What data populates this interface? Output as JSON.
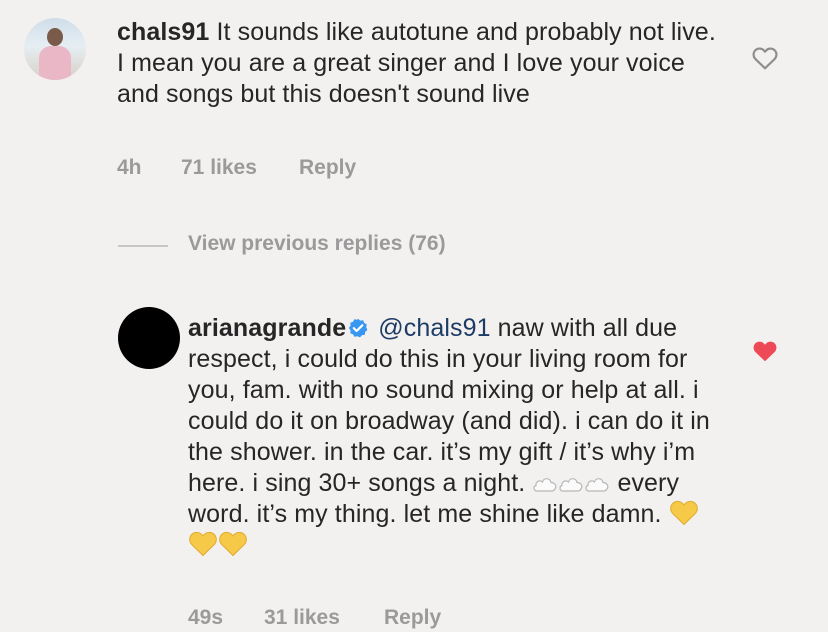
{
  "comments": [
    {
      "username": "chals91",
      "text": "It sounds like autotune and probably not live. I mean you are a great singer and I love your voice and songs but this doesn't sound live",
      "time": "4h",
      "likes": "71 likes",
      "reply_label": "Reply",
      "liked": false
    },
    {
      "username": "arianagrande",
      "verified": true,
      "mention": "@chals91",
      "text_before_emoji": "naw with all due respect, i could do this in your living room for you, fam. with no sound mixing or help at all. i could do it on broadway (and did). i can do it in the shower. in the car. it’s my gift / it’s why i’m here. i sing 30+ songs a night.",
      "emoji_1": "cloud-emoji",
      "text_after_emoji_1": "every word. it’s my thing. let me shine like damn.",
      "emoji_2": "yellow-heart-emoji",
      "time": "49s",
      "likes": "31 likes",
      "reply_label": "Reply",
      "liked": true
    }
  ],
  "view_previous_replies": "View previous replies (76)",
  "colors": {
    "background": "#f3f1ef",
    "meta_gray": "#9a9a9a",
    "like_red": "#ed4956",
    "mention_blue": "#1c3c66",
    "verified_blue": "#3897f0",
    "yellow_heart": "#f7c948"
  }
}
